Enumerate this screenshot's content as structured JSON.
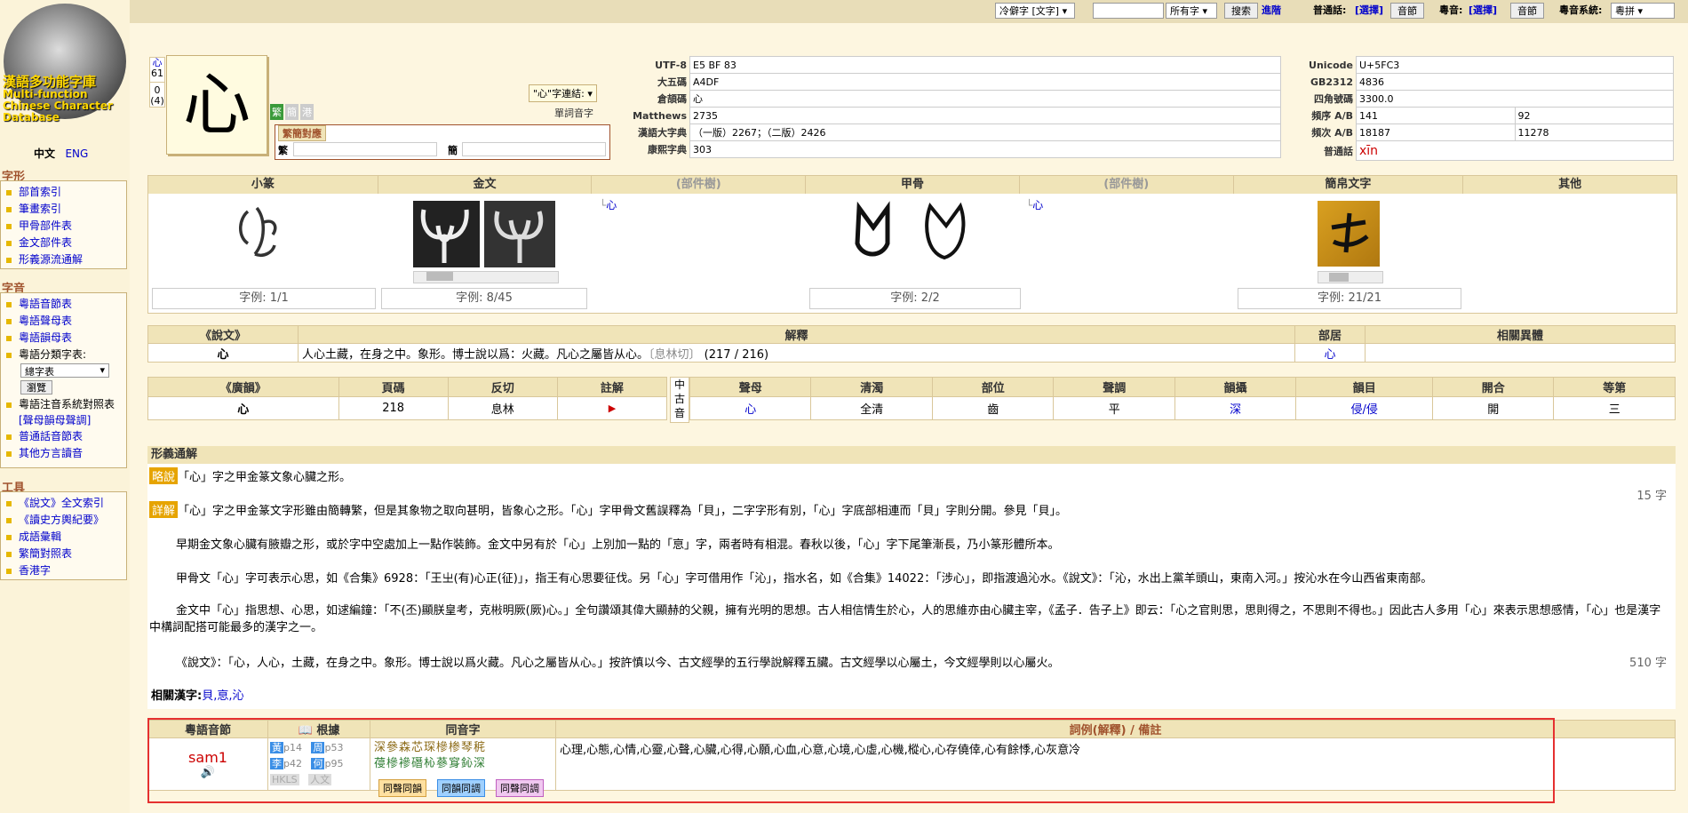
{
  "topbar": {
    "font_select": "冷僻字 [文字]",
    "search_value": "",
    "scope_select": "所有字",
    "search_button": "搜索",
    "advanced_link": "進階",
    "putonghua_label": "普通話:",
    "putonghua_choice": "[選擇]",
    "putonghua_audio": "音節",
    "cantonese_label": "粵音:",
    "cantonese_choice": "[選擇]",
    "cantonese_audio": "音節",
    "system_label": "粵音系統:",
    "system_select": "粵拼"
  },
  "sidebar": {
    "logo_title": "漢語多功能字庫",
    "logo_sub1": "Multi-function",
    "logo_sub2": "Chinese Character",
    "logo_sub3": "Database",
    "lang_zh": "中文",
    "lang_en": "ENG",
    "section1": {
      "title": "字形",
      "items": [
        "部首索引",
        "筆畫索引",
        "甲骨部件表",
        "金文部件表",
        "形義源流通解"
      ]
    },
    "section2": {
      "title": "字音",
      "items": [
        "粵語音節表",
        "粵語聲母表",
        "粵語韻母表",
        "粵語分類字表:"
      ],
      "select": "總字表",
      "browse_btn": "瀏覽",
      "items_b": [
        "粵語注音系統對照表",
        "[聲母韻母聲調]",
        "普通話音節表",
        "其他方言讀音"
      ]
    },
    "section3": {
      "title": "工具",
      "items": [
        "《說文》全文索引",
        "《讀史方輿紀要》",
        "成語彙輯",
        "繁簡對照表",
        "香港字"
      ]
    }
  },
  "char": {
    "radical_link": "心",
    "radical_strokes": "61",
    "stroke_extra": "0",
    "stroke_total": "(4)",
    "glyph": "心",
    "btn_trad": "繁",
    "btn_simp": "簡",
    "btn_variant": "港",
    "trad_simp_tab": "繁簡對應",
    "trad_label": "繁",
    "simp_label": "簡",
    "compound_select": "\"心\"字連結:",
    "single_audio": "單詞音字"
  },
  "codes_left": [
    {
      "label": "UTF-8",
      "value": "E5 BF 83"
    },
    {
      "label": "大五碼",
      "value": "A4DF"
    },
    {
      "label": "倉頡碼",
      "value": "心"
    },
    {
      "label": "Matthews",
      "value": "2735"
    },
    {
      "label": "漢語大字典",
      "value": "（一版）2267；（二版）2426"
    },
    {
      "label": "康熙字典",
      "value": "303"
    }
  ],
  "codes_right": [
    {
      "label": "Unicode",
      "value": "U+5FC3",
      "value2": ""
    },
    {
      "label": "GB2312",
      "value": "4836",
      "value2": ""
    },
    {
      "label": "四角號碼",
      "value": "3300.0",
      "value2": ""
    },
    {
      "label": "頻序 A/B",
      "value": "141",
      "value2": "92"
    },
    {
      "label": "頻次 A/B",
      "value": "18187",
      "value2": "11278"
    }
  ],
  "putonghua": {
    "label": "普通話",
    "pinyin": "xīn"
  },
  "scripts": {
    "headers": [
      "小篆",
      "金文",
      "(部件樹)",
      "甲骨",
      "(部件樹)",
      "簡帛文字",
      "其他"
    ],
    "tree_link1": "心",
    "tree_link2": "心",
    "examples": [
      "字例: 1/1",
      "字例: 8/45",
      "字例: 2/2",
      "字例: 21/21"
    ]
  },
  "shuowen": {
    "headers": [
      "《說文》",
      "解釋",
      "部居",
      "相關異體"
    ],
    "char": "心",
    "explanation": "人心土藏，在身之中。象形。博士說以爲：火藏。凡心之屬皆从心。",
    "fanqie": "〔息林切〕",
    "page": "(217 / 216)",
    "radical": "心",
    "variant": ""
  },
  "guangyun": {
    "headers": [
      "《廣韻》",
      "頁碼",
      "反切",
      "註解"
    ],
    "middle_chinese": [
      "中",
      "古",
      "音"
    ],
    "mc_headers": [
      "聲母",
      "清濁",
      "部位",
      "聲調",
      "韻攝",
      "韻目",
      "開合",
      "等第"
    ],
    "row": {
      "char": "心",
      "page": "218",
      "fanqie": "息林",
      "note": "▶"
    },
    "mc_row": [
      "心",
      "全清",
      "齒",
      "平",
      "深",
      "侵/侵",
      "開",
      "三"
    ]
  },
  "xingyi": {
    "title": "形義通解",
    "brief_tag": "略說",
    "brief": "「心」字之甲金篆文象心臟之形。",
    "brief_count": "15 字",
    "detail_tag": "詳解",
    "p1": "「心」字之甲金篆文字形雖由簡轉繁，但是其象物之取向甚明，皆象心之形。「心」字甲骨文舊誤釋為「貝」，二字字形有別，「心」字底部相連而「貝」字則分開。參見「貝」。",
    "p2": "早期金文象心臟有腋瓣之形，或於字中空處加上一點作裝飾。金文中另有於「心」上別加一點的「恴」字，兩者時有相混。春秋以後，「心」字下尾筆漸長，乃小篆形體所本。",
    "p3": "甲骨文「心」字可表示心思，如《合集》6928：「王㞢(有)心正(征)」，指王有心思要征伐。另「心」字可借用作「沁」，指水名，如《合集》14022：「涉心」，即指渡過沁水。《說文》：「沁，水出上黨羊頭山，東南入河。」按沁水在今山西省東南部。",
    "p4": "金文中「心」指思想、心思，如逑編鐘：「不(丕)顯朕皇考，克㪔明厥(厥)心。」全句讚頌其偉大顯赫的父親，擁有光明的思想。古人相信情生於心，人的思維亦由心臟主宰，《孟子．告子上》即云：「心之官則思，思則得之，不思則不得也。」因此古人多用「心」來表示思想感情，「心」也是漢字中構詞配搭可能最多的漢字之一。",
    "p5": "《說文》：「心，人心，土藏，在身之中。象形。博士說以爲火藏。凡心之屬皆从心。」按許慎以今、古文經學的五行學說解釋五臟。古文經學以心屬土，今文經學則以心屬火。",
    "detail_count": "510 字",
    "related_label": "相關漢字:",
    "related": "貝,恴,沁"
  },
  "cantonese": {
    "headers": [
      "粵語音節",
      "根據",
      "同音字",
      "詞例(解釋) / 備註"
    ],
    "syllable": "sam1",
    "refs": [
      "黃",
      "p14",
      "周",
      "p53",
      "李",
      "p42",
      "何",
      "p95",
      "HKLS",
      "",
      "人文",
      ""
    ],
    "homophones_row1": "深參森芯琛槮椮琴䅊",
    "homophones_row2": "葠槮襂䃡杺蔘䆤鈊深",
    "words": "心理,心態,心情,心靈,心聲,心臟,心得,心願,心血,心意,心境,心虛,心機,樅心,心存僥倖,心有餘悸,心灰意冷",
    "btn1": "同聲同韻",
    "btn2": "同韻同調",
    "btn3": "同聲同調"
  }
}
